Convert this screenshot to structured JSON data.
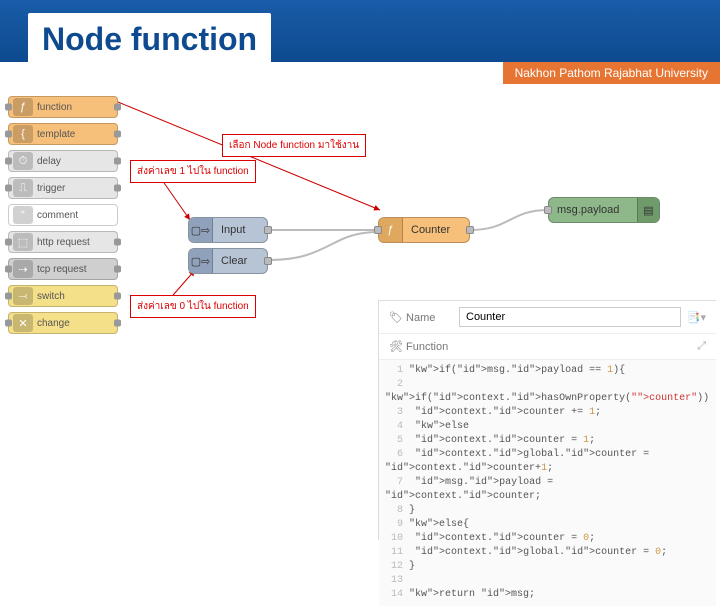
{
  "title": "Node function",
  "university": "Nakhon Pathom Rajabhat University",
  "palette": {
    "items": [
      {
        "label": "function",
        "icon": "ƒ",
        "bg": "#f7c07a",
        "hasR": true,
        "hasL": true
      },
      {
        "label": "template",
        "icon": "{",
        "bg": "#f7c07a",
        "hasR": true,
        "hasL": true
      },
      {
        "label": "delay",
        "icon": "⏱",
        "bg": "#e6e6e6",
        "hasR": true,
        "hasL": true
      },
      {
        "label": "trigger",
        "icon": "⎍",
        "bg": "#e6e6e6",
        "hasR": true,
        "hasL": true
      },
      {
        "label": "comment",
        "icon": "“",
        "bg": "#ffffff",
        "hasR": false,
        "hasL": false
      },
      {
        "label": "http request",
        "icon": "⬚",
        "bg": "#e6e6e6",
        "hasR": true,
        "hasL": true
      },
      {
        "label": "tcp request",
        "icon": "⇢",
        "bg": "#cfcfcf",
        "hasR": true,
        "hasL": true
      },
      {
        "label": "switch",
        "icon": "⤙",
        "bg": "#f5e08a",
        "hasR": true,
        "hasL": true
      },
      {
        "label": "change",
        "icon": "✕",
        "bg": "#f5e08a",
        "hasR": true,
        "hasL": true
      }
    ]
  },
  "callouts": {
    "select_function": "เลือก Node function มาใช้งาน",
    "send_1": "ส่งค่าเลข 1 ไปใน function",
    "send_0": "ส่งค่าเลข 0 ไปใน function"
  },
  "flow": {
    "input_label": "Input",
    "clear_label": "Clear",
    "counter_label": "Counter",
    "debug_label": "msg.payload"
  },
  "editor": {
    "name_label": "Name",
    "name_value": "Counter",
    "function_label": "Function",
    "code_lines": [
      "if(msg.payload == 1){",
      "    if(context.hasOwnProperty(\"counter\"))",
      "        context.counter += 1;",
      "    else",
      "        context.counter = 1;",
      "    context.global.counter = context.counter+1;",
      "    msg.payload = context.counter;",
      "}",
      "else{",
      "    context.counter = 0;",
      "    context.global.counter = 0;",
      "}",
      "",
      "return msg;"
    ]
  }
}
